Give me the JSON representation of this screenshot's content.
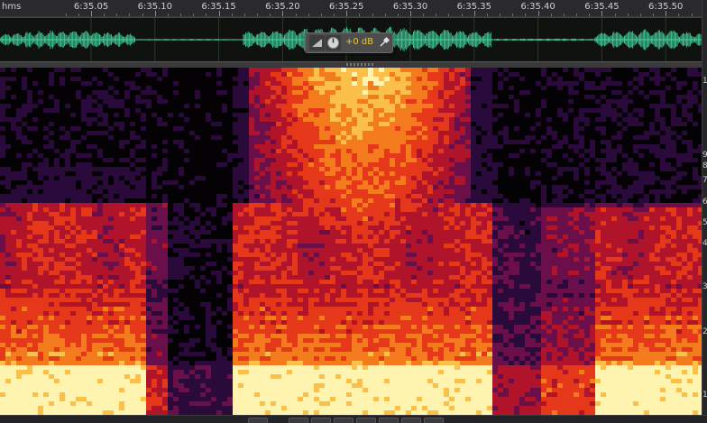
{
  "ruler": {
    "unit": "hms",
    "ticks": [
      {
        "t": "6:35.05"
      },
      {
        "t": "6:35.10"
      },
      {
        "t": "6:35.15"
      },
      {
        "t": "6:35.20"
      },
      {
        "t": "6:35.25"
      },
      {
        "t": "6:35.30"
      },
      {
        "t": "6:35.35"
      },
      {
        "t": "6:35.40"
      },
      {
        "t": "6:35.45"
      },
      {
        "t": "6:35.50"
      }
    ]
  },
  "hud": {
    "gain_value": "+0 dB",
    "buttons": [
      {
        "icon": "volume-ramp-icon"
      },
      {
        "icon": "gain-knob-icon"
      },
      {
        "icon": "pin-icon"
      }
    ]
  },
  "spectrogram": {
    "colormap": [
      "#050206",
      "#2a0a3a",
      "#6a0f4a",
      "#b0142a",
      "#e5381a",
      "#f47a1e",
      "#fbc04a",
      "#fff3b0"
    ]
  },
  "frequency_axis": {
    "labels": [
      "1",
      "9",
      "8",
      "7",
      "6",
      "5",
      "4",
      "3",
      "2",
      "1"
    ]
  },
  "colors": {
    "waveform": "#46d8a0",
    "gain_text": "#e9c542",
    "ruler_text": "#cfcfcf"
  }
}
